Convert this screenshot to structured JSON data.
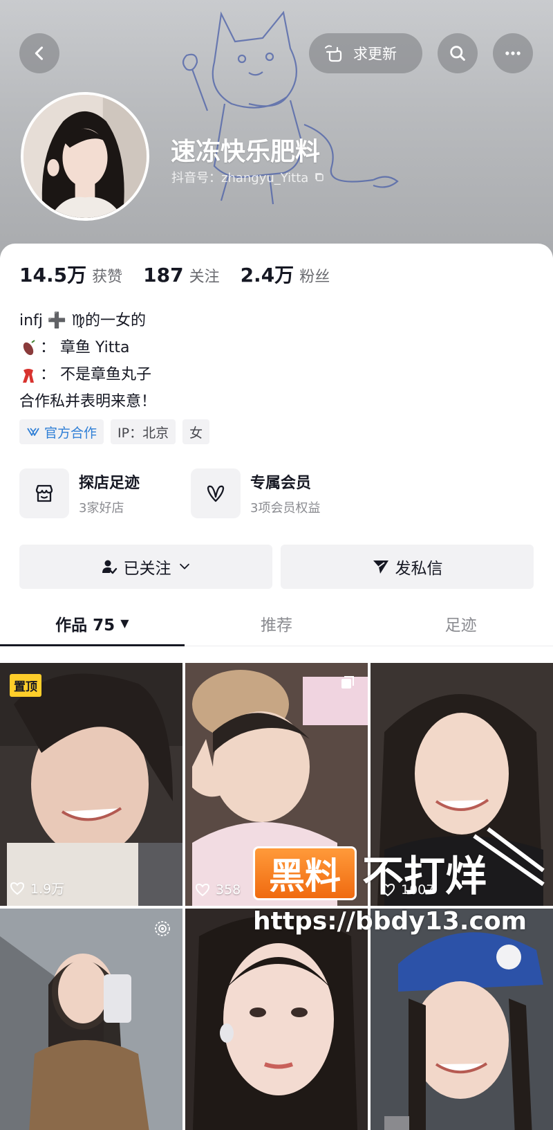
{
  "header": {
    "request_update_label": "求更新",
    "nickname": "速冻快乐肥料",
    "douyin_id": "抖音号：zhangyu_Yitta"
  },
  "stats": [
    {
      "num": "14.5万",
      "label": "获赞"
    },
    {
      "num": "187",
      "label": "关注"
    },
    {
      "num": "2.4万",
      "label": "粉丝"
    }
  ],
  "bio": {
    "line1": "infj ➕ ♍的一女的",
    "line2": "：  章鱼 Yitta",
    "line3": "：  不是章鱼丸子",
    "line4": "合作私并表明来意！"
  },
  "tags": {
    "official": "官方合作",
    "ip": "IP：北京",
    "gender": "女"
  },
  "features": [
    {
      "title": "探店足迹",
      "sub": "3家好店",
      "icon": "shop-icon"
    },
    {
      "title": "专属会员",
      "sub": "3项会员权益",
      "icon": "vip-heart-icon"
    }
  ],
  "actions": {
    "followed_label": "已关注",
    "message_label": "发私信"
  },
  "tabs": {
    "works": "作品 75",
    "recommend": "推荐",
    "footprint": "足迹"
  },
  "videos": [
    {
      "badge": "置顶",
      "likes": "1.9万"
    },
    {
      "likes": "358"
    },
    {
      "likes": "1007"
    },
    {
      "likes": ""
    },
    {
      "likes": ""
    },
    {
      "likes": ""
    }
  ],
  "watermark": {
    "box": "黑料",
    "rest": "不打烊",
    "url": "https://bbdy13.com"
  }
}
